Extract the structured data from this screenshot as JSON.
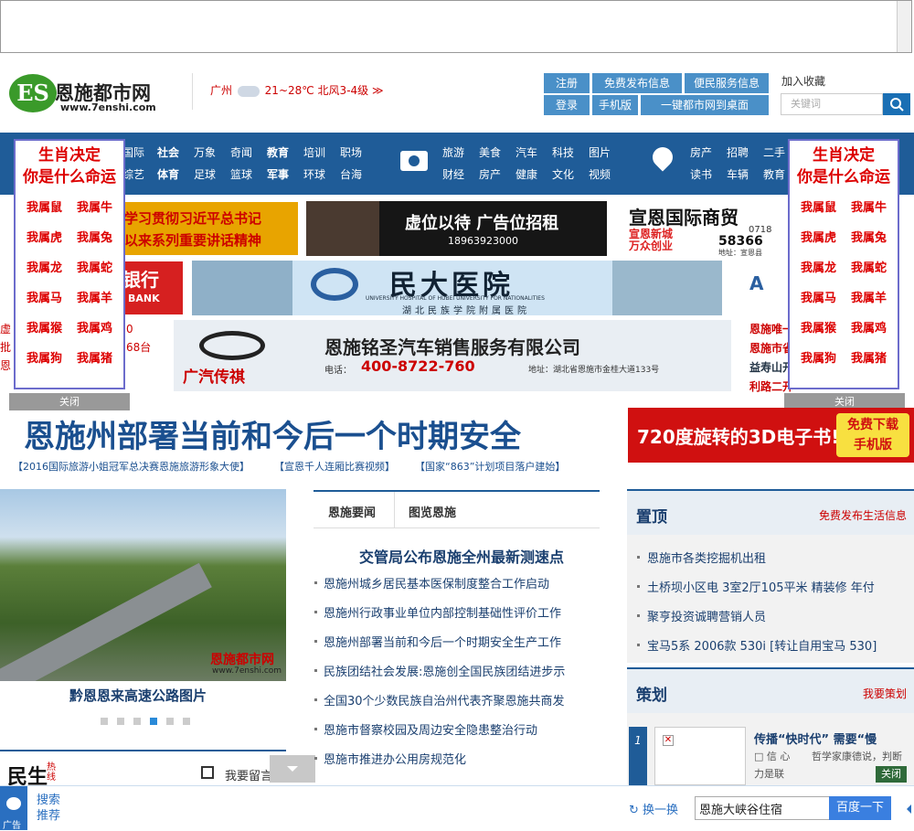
{
  "header": {
    "logo_badge": "ES",
    "logo_text": "恩施都市网",
    "logo_url": "www.7enshi.com",
    "city": "广州",
    "weather": "21~28℃ 北风3-4级 ≫",
    "buttons": [
      "注册",
      "免费发布信息",
      "便民服务信息",
      "登录",
      "手机版",
      "一键都市网到桌面"
    ],
    "add_fav": "加入收藏",
    "search_placeholder": "关键词"
  },
  "nav": {
    "g1_row1": [
      "国际",
      "社会",
      "万象",
      "奇闻",
      "教育",
      "培训",
      "职场"
    ],
    "g1_row2": [
      "综艺",
      "体育",
      "足球",
      "篮球",
      "军事",
      "环球",
      "台海"
    ],
    "g2_row1": [
      "旅游",
      "美食",
      "汽车",
      "科技",
      "图片"
    ],
    "g2_row2": [
      "财经",
      "房产",
      "健康",
      "文化",
      "视频"
    ],
    "g3_row1": [
      "房产",
      "招聘",
      "二手"
    ],
    "g3_row2": [
      "读书",
      "车辆",
      "教育"
    ]
  },
  "float_ad": {
    "title1": "生肖决定",
    "title2": "你是什么命运",
    "items": [
      "我属鼠",
      "我属牛",
      "我属虎",
      "我属兔",
      "我属龙",
      "我属蛇",
      "我属马",
      "我属羊",
      "我属猴",
      "我属鸡",
      "我属狗",
      "我属猪"
    ],
    "close": "关闭"
  },
  "ads": {
    "study1": "学习贯彻习近平总书记",
    "study2": "以来系列重要讲话精神",
    "vacant": "虚位以待 广告位招租",
    "vacant_phone": "18963923000",
    "trade": "宣恩国际商贸",
    "trade_phone": "0718",
    "trade_num": "58366",
    "trade_sub": "宣恩新城",
    "trade_sub2": "万众创业",
    "trade_addr": "地址：宣恩县",
    "bank": "银行",
    "bank_en": "BANK",
    "hospital": "民大医院",
    "hospital_en": "UNIVERSITY HOSPITAL OF HUBEI UNIVERSITY FOR NATIONALITIES",
    "hospital_sub": "湖北民族学院附属医院",
    "car_brand": "广汽传祺",
    "car_company": "恩施铭圣汽车销售服务有限公司",
    "car_phone_label": "电话：",
    "car_phone": "400-8722-760",
    "car_addr": "地址：湖北省恩施市金桂大道133号",
    "ebook": "720度旋转的3D电子书!",
    "ebook_dl": "免费下载",
    "ebook_dl2": "手机版",
    "left_bits": [
      "虚",
      "批",
      "恩",
      "恩"
    ],
    "left_bits2": [
      "0",
      "68台"
    ],
    "right_bits": [
      "恩施唯一",
      "恩施市省",
      "益寿山开",
      "利路二开"
    ]
  },
  "main": {
    "headline": "恩施州部署当前和今后一个时期安全",
    "sublinks": [
      "【2016国际旅游小姐冠军总决赛恩施旅游形象大使】",
      "【宣恩千人连厢比赛视频】",
      "【国家“863”计划项目落户建始】"
    ],
    "photo_caption": "黔恩恩来高速公路图片",
    "photo_watermark": "恩施都市网",
    "photo_watermark_url": "www.7enshi.com",
    "tabs": [
      "恩施要闻",
      "图览恩施"
    ],
    "top_news": "交管局公布恩施全州最新测速点",
    "news": [
      "恩施州城乡居民基本医保制度整合工作启动",
      "恩施州行政事业单位内部控制基础性评价工作",
      "恩施州部署当前和今后一个时期安全生产工作",
      "民族团结社会发展:恩施创全国民族团结进步示",
      "全国30个少数民族自治州代表齐聚恩施共商发",
      "恩施市督察校园及周边安全隐患整治行动",
      "恩施市推进办公用房规范化"
    ],
    "minsheng": "民生",
    "minsheng_hot": "热线",
    "leave_msg": "我要留言"
  },
  "right": {
    "top_title": "置顶",
    "top_link": "免费发布生活信息",
    "top_items": [
      "恩施市各类挖掘机出租",
      "土桥坝小区电 3室2厅105平米 精装修 年付",
      "聚亨投资诚聘营销人员",
      "宝马5系 2006款 530i [转让自用宝马 530]"
    ],
    "plan_title": "策划",
    "plan_link": "我要策划",
    "plan_num": "1",
    "plan_headline": "传播“快时代” 需要“慢",
    "plan_text1": "信 心",
    "plan_text2": "哲学家康德说，判断",
    "plan_text3": "力是联",
    "plan_close": "关闭"
  },
  "bottom": {
    "ad_label": "广告",
    "search": "搜索",
    "recommend": "推荐",
    "refresh": "换一换",
    "query": "恩施大峡谷住宿",
    "btn": "百度一下"
  }
}
